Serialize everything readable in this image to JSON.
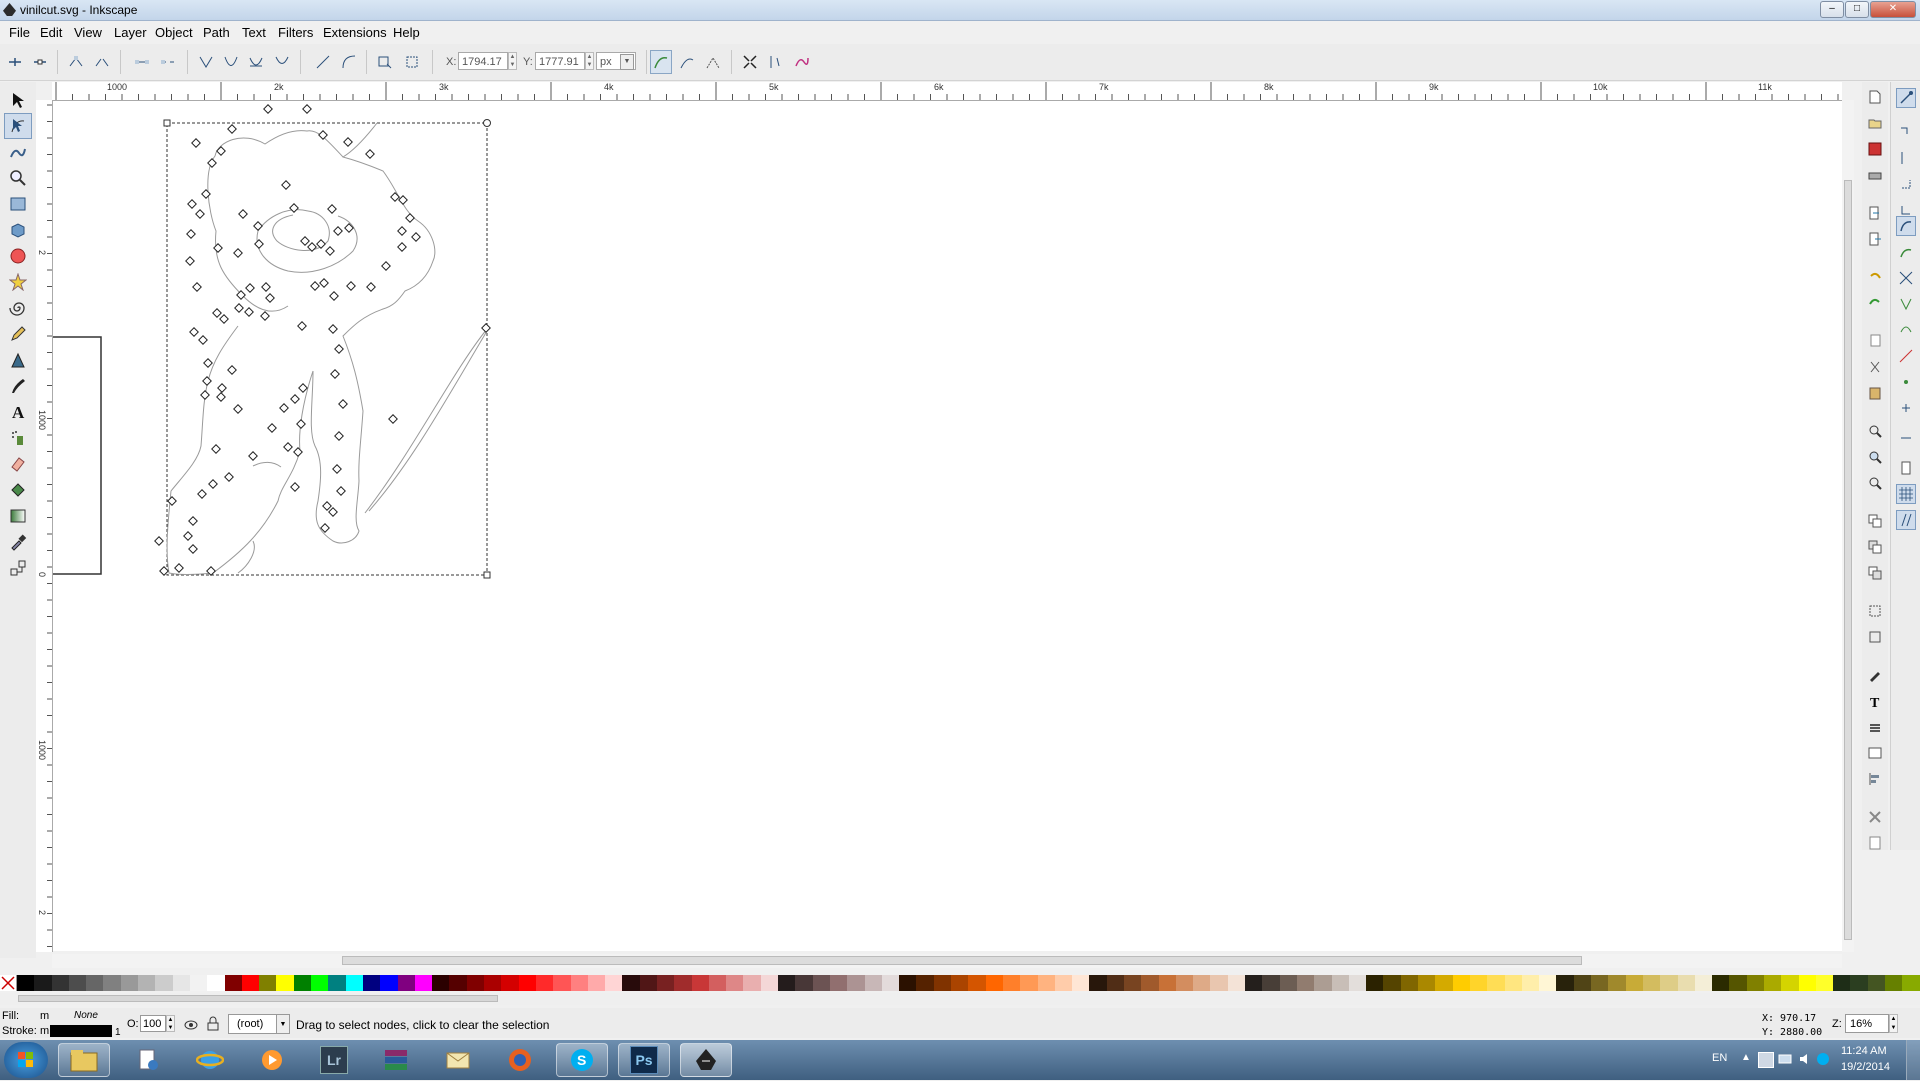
{
  "window": {
    "title": "vinilcut.svg - Inkscape",
    "min": "–",
    "max": "□",
    "close": "✕"
  },
  "menu": [
    "File",
    "Edit",
    "View",
    "Layer",
    "Object",
    "Path",
    "Text",
    "Filters",
    "Extensions",
    "Help"
  ],
  "toolbar": {
    "x_label": "X:",
    "x_value": "1794.17",
    "y_label": "Y:",
    "y_value": "1777.91",
    "unit": "px"
  },
  "ruler": {
    "h_labels": [
      "1000",
      "2k",
      "3k",
      "4k",
      "5k",
      "6k",
      "7k",
      "8k",
      "9k",
      "10k",
      "11k"
    ],
    "v_labels": [
      "2",
      "1000",
      "0",
      "1000",
      "2"
    ]
  },
  "status": {
    "fill_label": "Fill:",
    "fill_value": "m",
    "fill_none": "None",
    "stroke_label": "Stroke:",
    "stroke_value": "m",
    "stroke_width": "1",
    "opacity_label": "O:",
    "opacity_value": "100",
    "layer": "(root)",
    "message": "Drag to select nodes, click to clear the selection",
    "cursor_x": "X:  970.17",
    "cursor_y": "Y: 2880.00",
    "zoom_label": "Z:",
    "zoom_value": "16%"
  },
  "taskbar": {
    "lang": "EN",
    "time": "11:24 AM",
    "date": "19/2/2014",
    "lr": "Lr",
    "ps": "Ps"
  },
  "icons": {
    "tools": [
      "selector-icon",
      "node-editor-icon",
      "tweak-icon",
      "zoom-icon",
      "rectangle-icon",
      "3d-box-icon",
      "ellipse-icon",
      "star-icon",
      "spiral-icon",
      "pencil-icon",
      "pen-icon",
      "calligraphy-icon",
      "text-icon",
      "spray-icon",
      "eraser-icon",
      "paint-bucket-icon",
      "gradient-icon",
      "dropper-icon",
      "connector-icon"
    ]
  },
  "palette": [
    "#000000",
    "#1a1a1a",
    "#333333",
    "#4d4d4d",
    "#666666",
    "#808080",
    "#999999",
    "#b3b3b3",
    "#cccccc",
    "#e6e6e6",
    "#f2f2f2",
    "#ffffff",
    "#800000",
    "#ff0000",
    "#808000",
    "#ffff00",
    "#008000",
    "#00ff00",
    "#008080",
    "#00ffff",
    "#000080",
    "#0000ff",
    "#800080",
    "#ff00ff",
    "#2b0000",
    "#550000",
    "#800000",
    "#aa0000",
    "#d40000",
    "#ff0000",
    "#ff2a2a",
    "#ff5555",
    "#ff8080",
    "#ffaaaa",
    "#ffd5d5",
    "#280b0b",
    "#501616",
    "#782121",
    "#a02c2c",
    "#c83737",
    "#d35f5f",
    "#de8787",
    "#e9afaf",
    "#f4d7d7",
    "#241c1c",
    "#483737",
    "#6c5353",
    "#916f6f",
    "#ac9393",
    "#c8b7b7",
    "#e3dbdb",
    "#2b1100",
    "#552200",
    "#803300",
    "#aa4400",
    "#d45500",
    "#ff6600",
    "#ff7f2a",
    "#ff9955",
    "#ffb380",
    "#ffccaa",
    "#ffe6d5",
    "#28170b",
    "#502d16",
    "#784421",
    "#a05a2c",
    "#c87137",
    "#d38d5f",
    "#deaa87",
    "#e9c6af",
    "#f4e3d7",
    "#241f1c",
    "#483e37",
    "#6c5d53",
    "#917c6f",
    "#ac9d93",
    "#c8beb7",
    "#e3dedb",
    "#2b2200",
    "#554400",
    "#806600",
    "#aa8800",
    "#d4aa00",
    "#ffcc00",
    "#ffd42a",
    "#ffdd55",
    "#ffe680",
    "#ffeeaa",
    "#fff6d5",
    "#28220b",
    "#504416",
    "#786721",
    "#a0892c",
    "#c8ab37",
    "#d3bc5f",
    "#decd87",
    "#e9ddaf",
    "#f4eed7",
    "#2b2b00",
    "#555500",
    "#808000",
    "#aaaa00",
    "#d4d400",
    "#ffff00",
    "#ffff2a",
    "#1e2d17",
    "#2b3e20",
    "#445522",
    "#668000",
    "#88aa00"
  ]
}
